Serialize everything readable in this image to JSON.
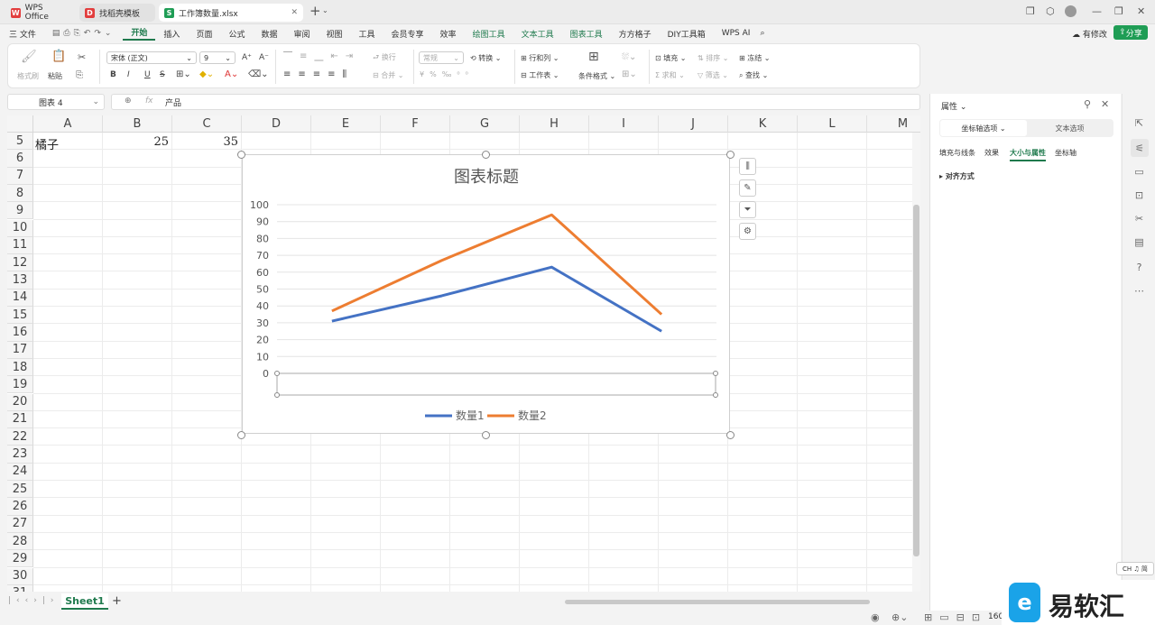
{
  "tabs": [
    {
      "label": "WPS Office",
      "logo": "W",
      "color": "#e23d3d"
    },
    {
      "label": "找稻壳模板",
      "logo": "D",
      "color": "#e23d3d"
    },
    {
      "label": "工作簿数量.xlsx",
      "logo": "S",
      "color": "#1f9d55"
    }
  ],
  "menus": [
    "三 文件",
    "开始",
    "插入",
    "页面",
    "公式",
    "数据",
    "审阅",
    "视图",
    "工具",
    "会员专享",
    "效率",
    "绘图工具",
    "文本工具",
    "图表工具",
    "方方格子",
    "DIY工具箱",
    "WPS AI"
  ],
  "menubar_right": {
    "modify": "有修改",
    "share": "分享"
  },
  "ribbon": {
    "format_painter": "格式刷",
    "paste": "粘贴",
    "font": "宋体 (正文)",
    "size": "9",
    "bold": "B",
    "italic": "I",
    "underline": "U",
    "strike": "S",
    "wrap": "换行",
    "merge": "合并",
    "num_format": "常规",
    "convert": "转换",
    "rowcol": "行和列",
    "worksheet": "工作表",
    "cond_format": "条件格式",
    "fill": "填充",
    "sort": "排序",
    "freeze": "冻结",
    "sum": "求和",
    "filter": "筛选",
    "find": "查找"
  },
  "namebox": "图表 4",
  "formula": "产品",
  "fx": "fx",
  "columns": [
    "A",
    "B",
    "C",
    "D",
    "E",
    "F",
    "G",
    "H",
    "I",
    "J",
    "K",
    "L",
    "M"
  ],
  "rows": [
    "5",
    "6",
    "7",
    "8",
    "9",
    "10",
    "11",
    "12",
    "13",
    "14",
    "15",
    "16",
    "17",
    "18",
    "19",
    "20",
    "21",
    "22",
    "23",
    "24",
    "25",
    "26",
    "27",
    "28",
    "29",
    "30",
    "31"
  ],
  "cells": {
    "a5": "橘子",
    "b5": "25",
    "c5": "35"
  },
  "chart_data": {
    "type": "line",
    "title": "图表标题",
    "categories": [
      "",
      "",
      "",
      ""
    ],
    "series": [
      {
        "name": "数量1",
        "color": "#4472c4",
        "values": [
          31,
          46,
          63,
          25
        ]
      },
      {
        "name": "数量2",
        "color": "#ed7d31",
        "values": [
          37,
          67,
          94,
          35
        ]
      }
    ],
    "ylim": [
      0,
      100
    ],
    "yticks": [
      "0",
      "10",
      "20",
      "30",
      "40",
      "50",
      "60",
      "70",
      "80",
      "90",
      "100"
    ],
    "grid": true,
    "legend": "bottom"
  },
  "sheet_tab": "Sheet1",
  "add_sheet": "+",
  "panel": {
    "title": "属性",
    "tab1": "坐标轴选项",
    "tab2": "文本选项",
    "subtabs": [
      "填充与线条",
      "效果",
      "大小与属性",
      "坐标轴"
    ],
    "section": "对齐方式"
  },
  "status": {
    "zoom": "160"
  },
  "ime": "CH ♫ 简",
  "watermark": "易软汇"
}
